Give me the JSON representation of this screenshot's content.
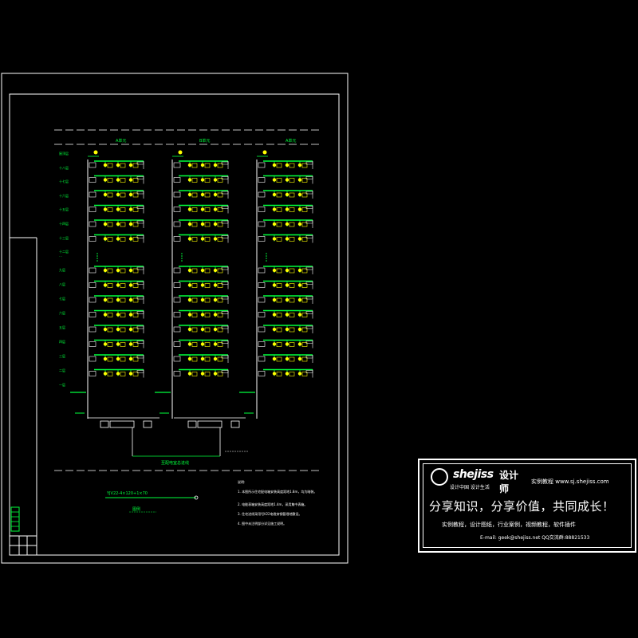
{
  "drawing": {
    "units": [
      "A单元",
      "B单元",
      "A单元"
    ],
    "floor_labels": [
      "屋顶层",
      "十八层",
      "十七层",
      "十六层",
      "十五层",
      "十四层",
      "十三层",
      "十二层",
      "…",
      "九层",
      "八层",
      "七层",
      "六层",
      "五层",
      "四层",
      "三层",
      "二层",
      "一层"
    ],
    "main_cable_label": "至配电室总进线",
    "cable_note": "YJV22-4×120+1×70",
    "legend_title": "图例",
    "colors": {
      "line": "#ffffff",
      "green": "#00ff3c",
      "yellow": "#ffff00"
    }
  },
  "notes": {
    "title": "说明:",
    "items": [
      "1. 本图所示住宅配电箱安装高度距地1.8m，均为暗装。",
      "2. 电能表箱安装高度距地1.4m，采用集中表箱。",
      "3. 住宅进线采用YJV22电缆穿钢管埋地敷设。",
      "4. 图中未注明部分详见施工说明。"
    ]
  },
  "banner": {
    "logo_word": "shejiss",
    "logo_cn": "设计师",
    "logo_sub": "设计中国  设计生活",
    "site_line": "实例教程 www.sj.shejiss.com",
    "slogan": "分享知识，分享价值，共同成长！",
    "desc": "实例教程，设计图纸，行业案例，视频教程，软件插件",
    "contact": "E-mail: geek@shejiss.net  QQ交流群:88821533"
  }
}
